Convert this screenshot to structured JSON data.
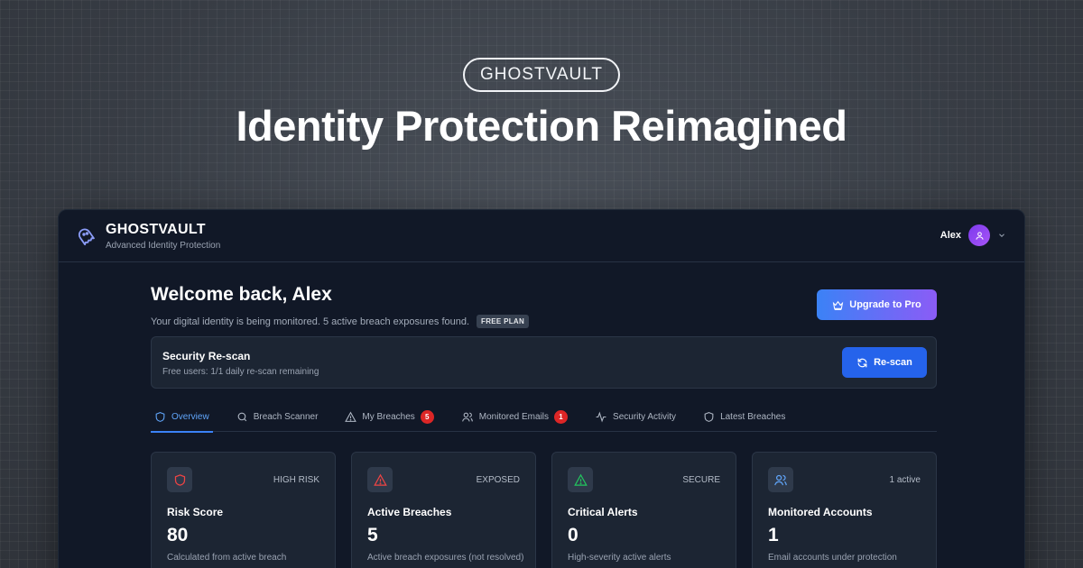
{
  "hero": {
    "badge": "GHOSTVAULT",
    "title": "Identity Protection Reimagined"
  },
  "header": {
    "brand": "GHOSTVAULT",
    "tagline": "Advanced Identity Protection",
    "user_name": "Alex",
    "icons": {
      "logo": "ghost-icon",
      "avatar": "user-icon",
      "menu": "chevron-down-icon"
    }
  },
  "welcome": {
    "title": "Welcome back, Alex",
    "subtitle": "Your digital identity is being monitored. 5 active breach exposures found.",
    "plan_badge": "FREE PLAN",
    "upgrade_label": "Upgrade to Pro"
  },
  "rescan": {
    "title": "Security Re-scan",
    "subtitle": "Free users: 1/1 daily re-scan remaining",
    "button_label": "Re-scan"
  },
  "tabs": [
    {
      "label": "Overview",
      "icon": "shield-icon",
      "active": true
    },
    {
      "label": "Breach Scanner",
      "icon": "search-icon"
    },
    {
      "label": "My Breaches",
      "icon": "warning-icon",
      "count": "5"
    },
    {
      "label": "Monitored Emails",
      "icon": "users-icon",
      "count": "1"
    },
    {
      "label": "Security Activity",
      "icon": "activity-icon"
    },
    {
      "label": "Latest Breaches",
      "icon": "shield-icon"
    }
  ],
  "stats": [
    {
      "icon": "shield-icon",
      "tag": "HIGH RISK",
      "title": "Risk Score",
      "value": "80",
      "desc": "Calculated from active breach",
      "color": "#ef4444"
    },
    {
      "icon": "warning-icon",
      "tag": "EXPOSED",
      "title": "Active Breaches",
      "value": "5",
      "desc": "Active breach exposures (not resolved)",
      "color": "#ef4444"
    },
    {
      "icon": "warning-icon",
      "tag": "SECURE",
      "title": "Critical Alerts",
      "value": "0",
      "desc": "High-severity active alerts",
      "color": "#22c55e"
    },
    {
      "icon": "users-icon",
      "tag": "1 active",
      "title": "Monitored Accounts",
      "value": "1",
      "desc": "Email accounts under protection",
      "color": "#60a5fa"
    }
  ],
  "colors": {
    "accent": "#3b82f6",
    "danger": "#dc2626",
    "bg": "#111827"
  }
}
